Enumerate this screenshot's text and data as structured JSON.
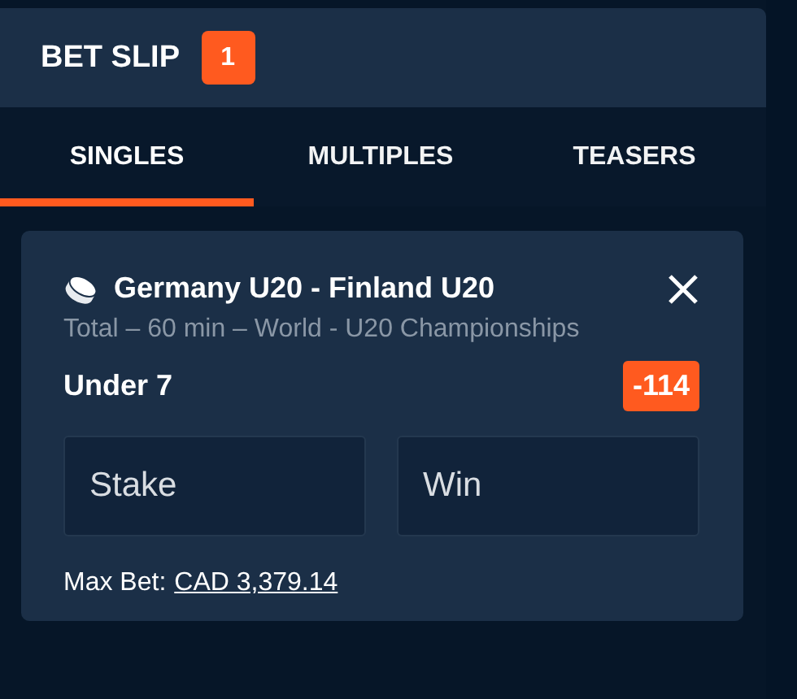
{
  "header": {
    "title": "BET SLIP",
    "count": "1"
  },
  "tabs": [
    {
      "label": "SINGLES",
      "selected": true
    },
    {
      "label": "MULTIPLES",
      "selected": false
    },
    {
      "label": "TEASERS",
      "selected": false
    }
  ],
  "bet": {
    "event": "Germany U20 - Finland U20",
    "market": "Total – 60 min – World - U20 Championships",
    "selection": "Under 7",
    "odds": "-114",
    "stake": {
      "placeholder": "Stake"
    },
    "win": {
      "placeholder": "Win"
    },
    "max_bet_label": "Max Bet:",
    "max_bet_amount": "CAD 3,379.14"
  }
}
